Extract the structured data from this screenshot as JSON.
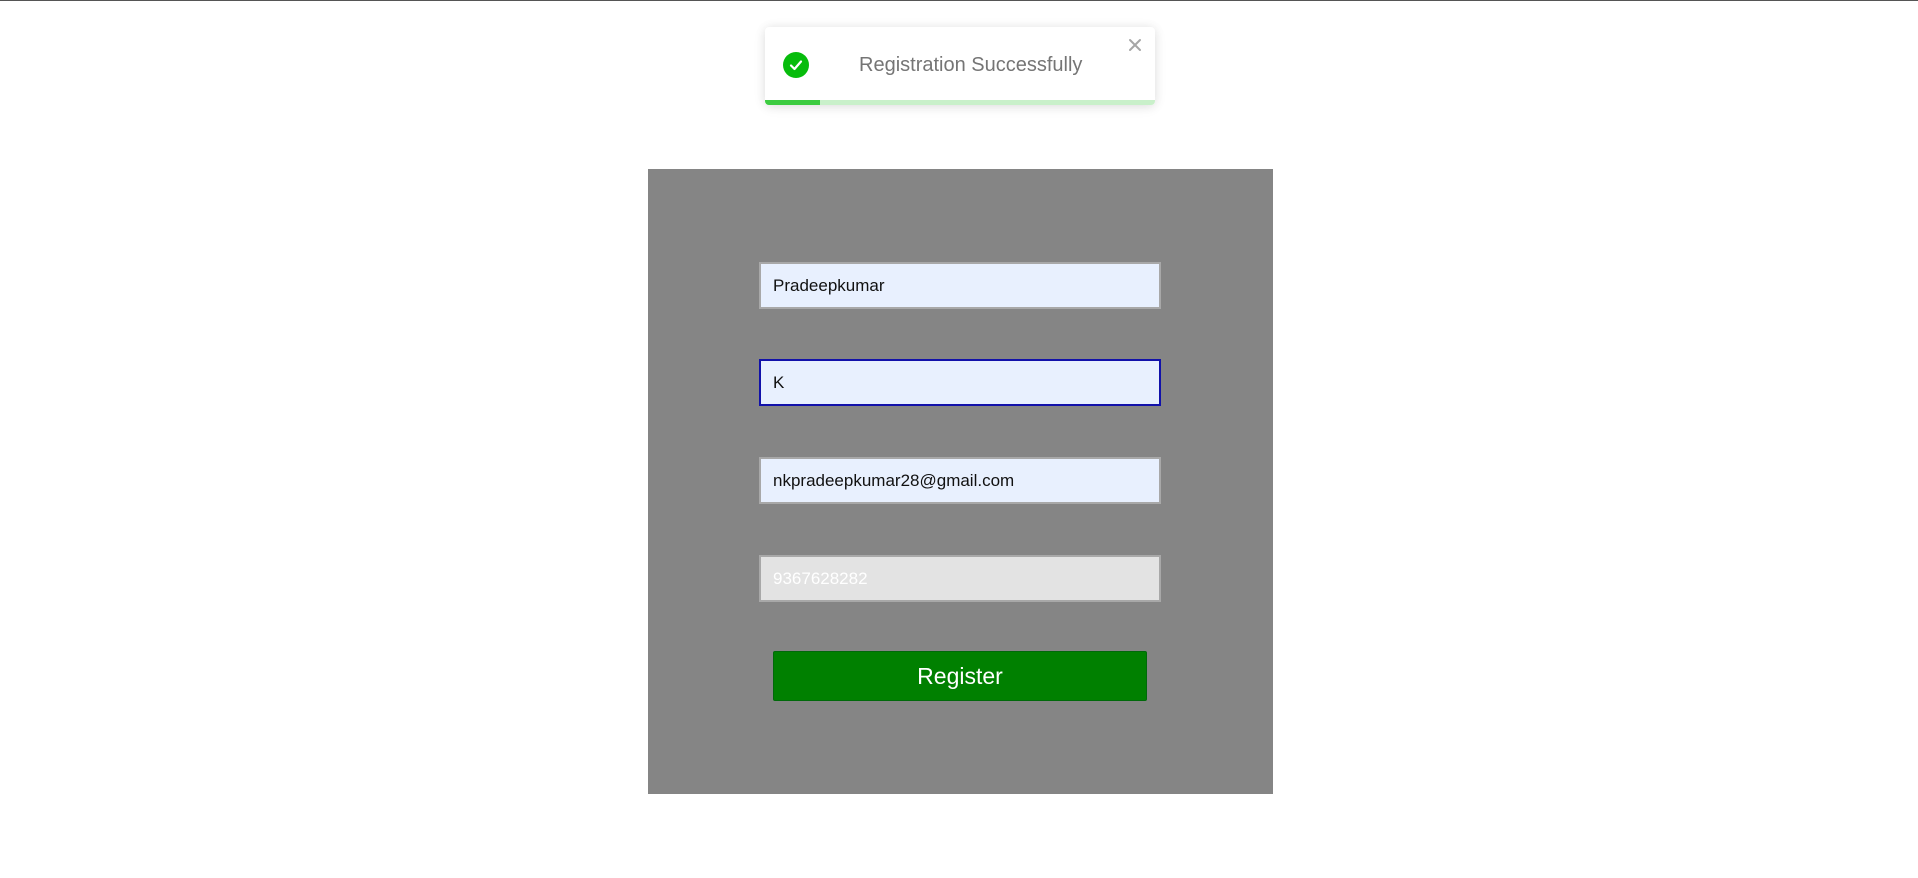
{
  "toast": {
    "message": "Registration Successfully",
    "progress_percent": 14,
    "success_color": "#07bc0c",
    "close_icon": "close-icon",
    "status_icon": "check-circle-icon"
  },
  "form": {
    "first_name_value": "Pradeepkumar",
    "last_name_value": "K",
    "email_value": "nkpradeepkumar28@gmail.com",
    "phone_value": "9367628282",
    "register_label": "Register",
    "button_color": "#008000",
    "panel_color": "#858585"
  }
}
